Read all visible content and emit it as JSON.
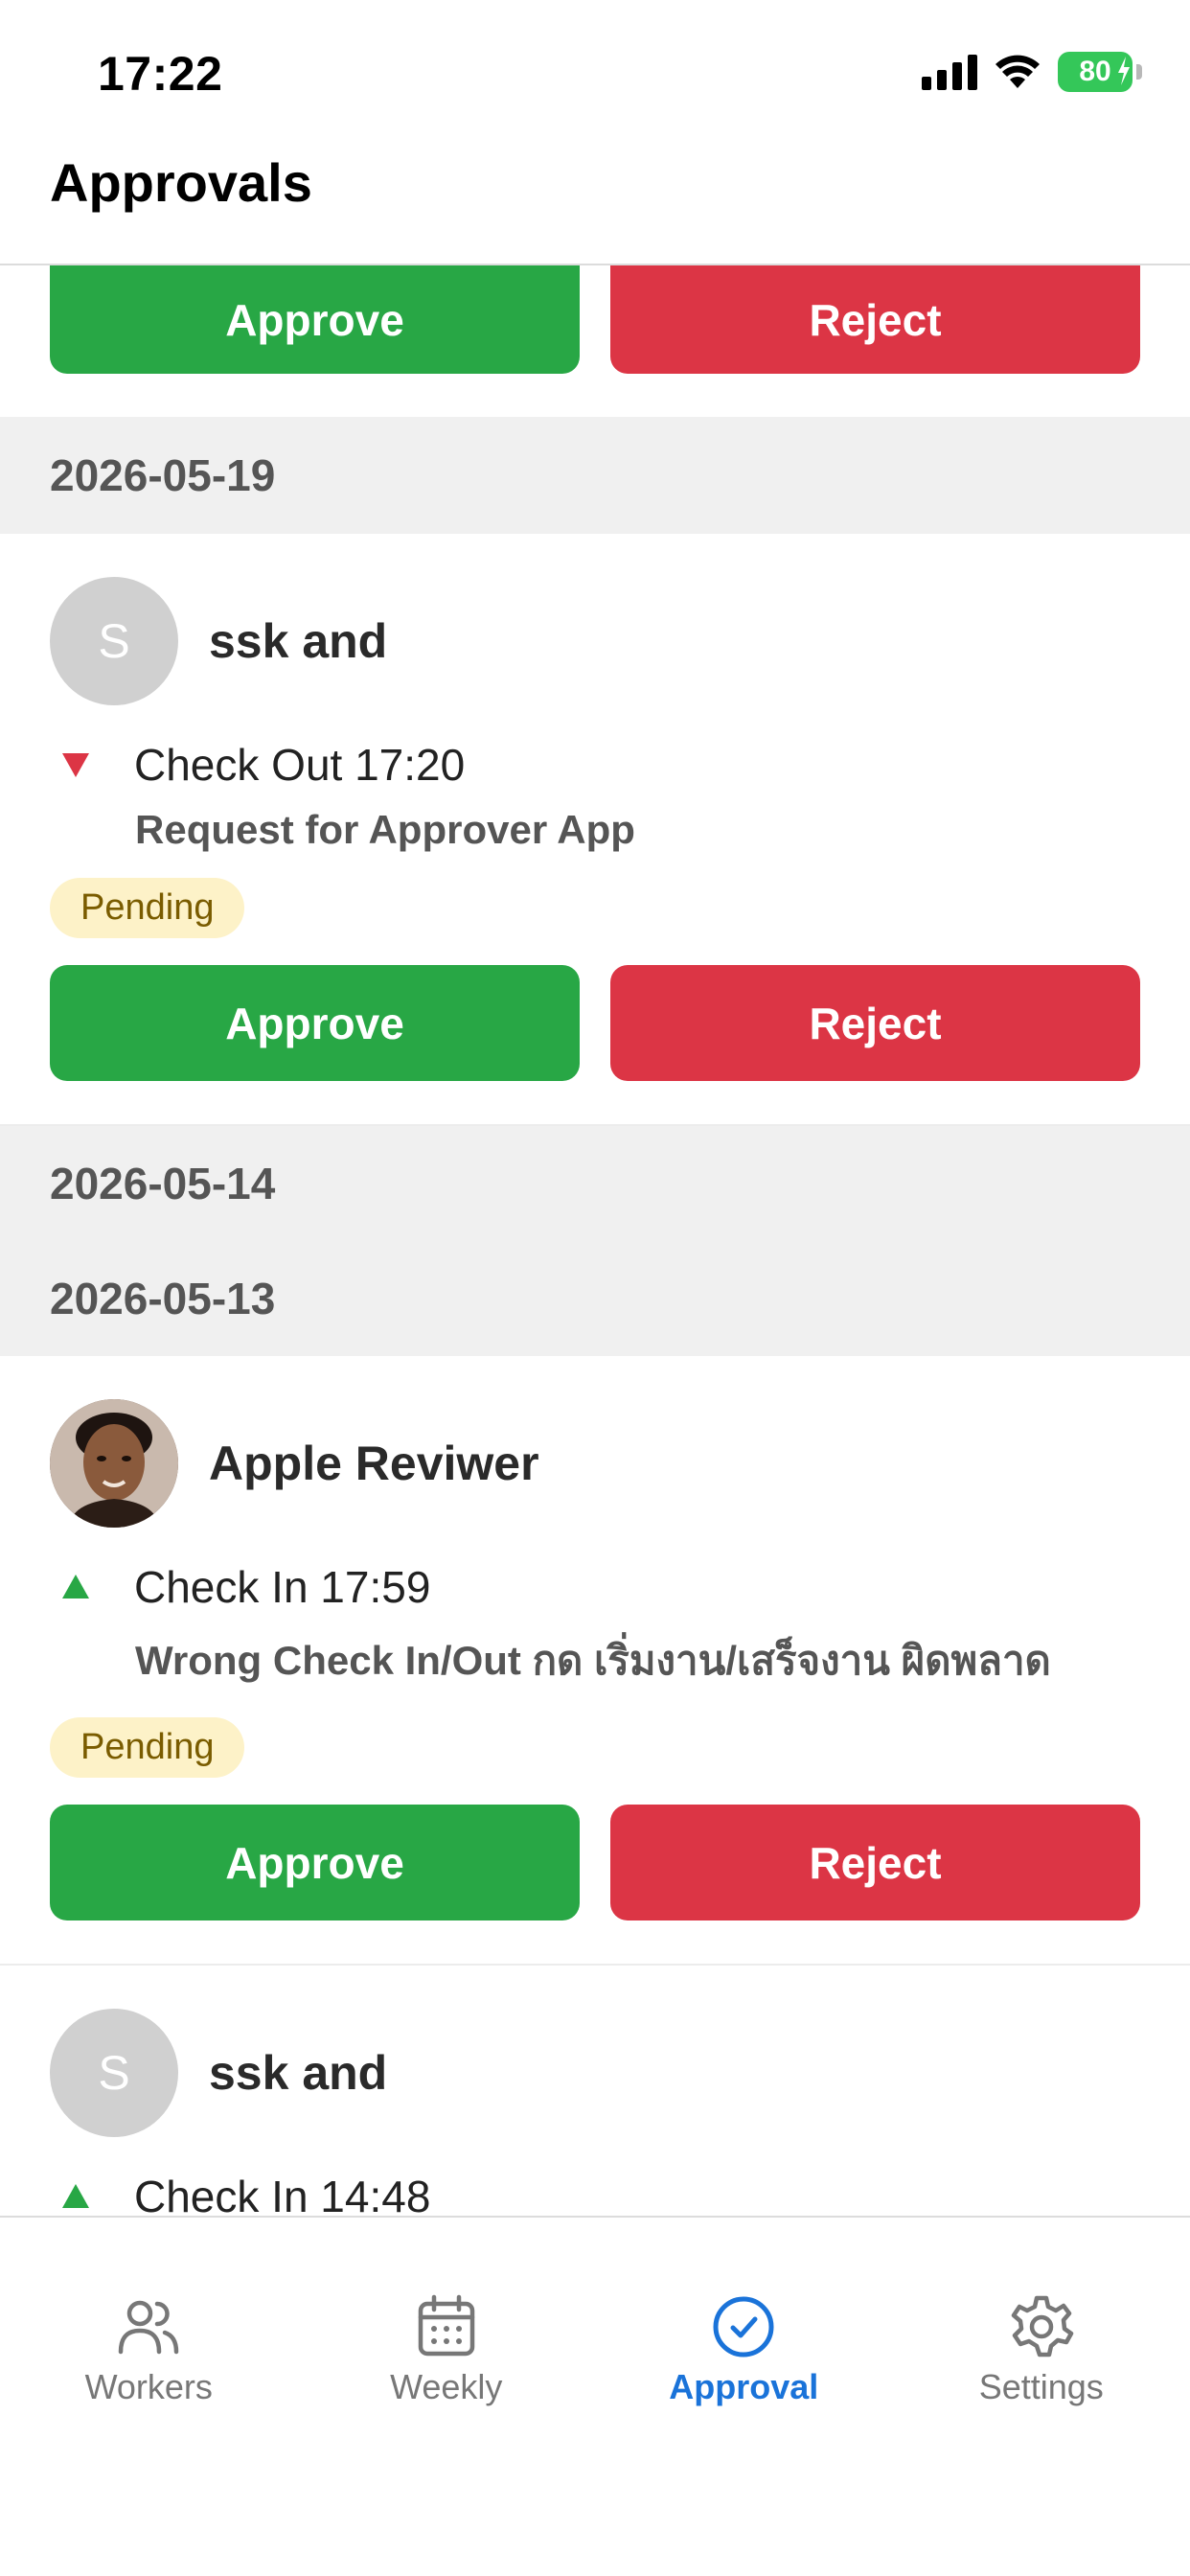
{
  "status_bar": {
    "time": "17:22",
    "battery": "80"
  },
  "header": {
    "title": "Approvals"
  },
  "top_card": {
    "approve_label": "Approve",
    "reject_label": "Reject"
  },
  "groups": [
    {
      "date": "2026-05-19",
      "requests": [
        {
          "avatar_initial": "S",
          "name": "ssk and",
          "event": "Check Out 17:20",
          "event_type": "check-out",
          "reason": "Request for Approver App",
          "status": "Pending",
          "approve_label": "Approve",
          "reject_label": "Reject"
        }
      ]
    },
    {
      "date": "2026-05-14",
      "requests": []
    },
    {
      "date": "2026-05-13",
      "requests": [
        {
          "avatar_initial": "",
          "name": "Apple Reviwer",
          "event": "Check In 17:59",
          "event_type": "check-in",
          "reason": "Wrong Check In/Out กด เริ่มงาน/เสร็จงาน ผิดพลาด",
          "status": "Pending",
          "approve_label": "Approve",
          "reject_label": "Reject"
        },
        {
          "avatar_initial": "S",
          "name": "ssk and",
          "event": "Check In 14:48",
          "event_type": "check-in"
        }
      ]
    }
  ],
  "tabs": [
    {
      "label": "Workers",
      "icon": "users-icon",
      "active": false
    },
    {
      "label": "Weekly",
      "icon": "calendar-icon",
      "active": false
    },
    {
      "label": "Approval",
      "icon": "check-circle-icon",
      "active": true
    },
    {
      "label": "Settings",
      "icon": "gear-icon",
      "active": false
    }
  ],
  "colors": {
    "approve": "#28a745",
    "reject": "#dc3545",
    "check_in": "#28a745",
    "check_out": "#dc3545",
    "pending_bg": "#fdf2c8",
    "pending_text": "#7a5c00",
    "tab_active": "#1a73d9",
    "tab_inactive": "#777777"
  }
}
